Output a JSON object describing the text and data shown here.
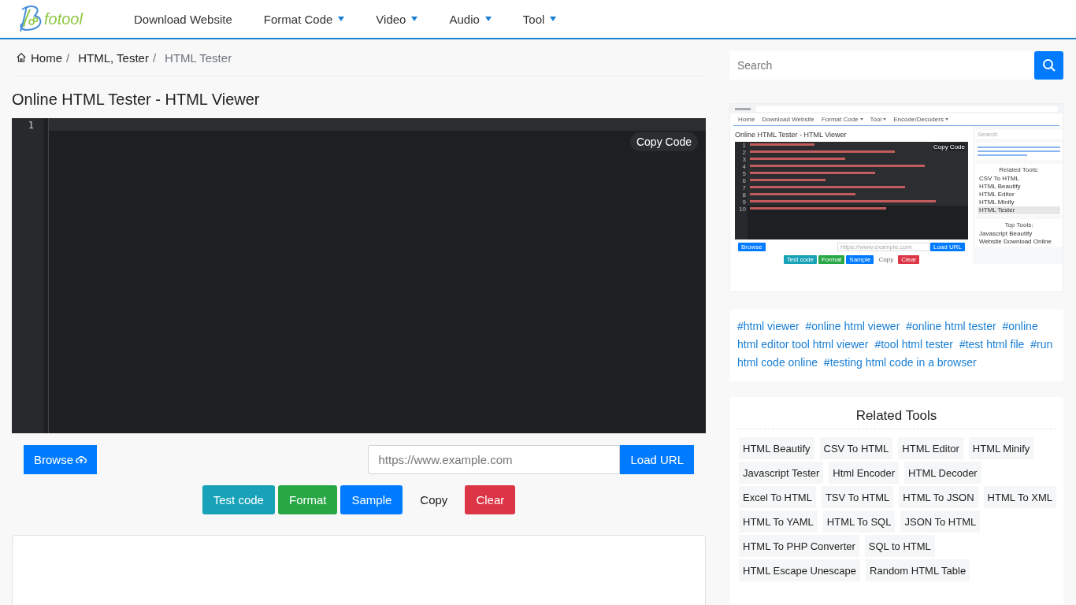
{
  "logo": {
    "text": "fotool"
  },
  "nav": [
    {
      "label": "Download Website",
      "dropdown": false
    },
    {
      "label": "Format Code",
      "dropdown": true
    },
    {
      "label": "Video",
      "dropdown": true
    },
    {
      "label": "Audio",
      "dropdown": true
    },
    {
      "label": "Tool",
      "dropdown": true
    }
  ],
  "breadcrumb": [
    {
      "label": "Home",
      "kind": "home",
      "separator": "/"
    },
    {
      "label": "HTML, Tester",
      "kind": "link",
      "separator": "/"
    },
    {
      "label": "HTML Tester",
      "kind": "current"
    }
  ],
  "title": "Online HTML Tester - HTML Viewer",
  "editor": {
    "line_numbers": [
      "1"
    ],
    "copy_button": "Copy Code"
  },
  "browse_button": "Browse",
  "url_field": {
    "placeholder": "https://www.example.com"
  },
  "load_button": "Load URL",
  "actions": [
    {
      "label": "Test code",
      "kind": "filled",
      "color": "#17a2b8"
    },
    {
      "label": "Format",
      "kind": "filled",
      "color": "#28a745"
    },
    {
      "label": "Sample",
      "kind": "filled",
      "color": "#007bff"
    },
    {
      "label": "Copy",
      "kind": "plain"
    },
    {
      "label": "Clear",
      "kind": "filled",
      "color": "#dc3545"
    }
  ],
  "search": {
    "placeholder": "Search"
  },
  "preview": {
    "nav": [
      {
        "label": "Home",
        "dropdown": false
      },
      {
        "label": "Download Website",
        "dropdown": false
      },
      {
        "label": "Format Code",
        "dropdown": true
      },
      {
        "label": "Tool",
        "dropdown": true
      },
      {
        "label": "Encode/Decoders",
        "dropdown": true
      }
    ],
    "title": "Online HTML Tester - HTML Viewer",
    "copy_button": "Copy Code",
    "line_numbers": [
      "1",
      "2",
      "3",
      "4",
      "5",
      "6",
      "7",
      "8",
      "9",
      "10"
    ],
    "search_placeholder": "Search",
    "related_title": "Related Tools:",
    "related_items": [
      {
        "label": "CSV To HTML",
        "selected": false
      },
      {
        "label": "HTML Beautify",
        "selected": false
      },
      {
        "label": "HTML Editor",
        "selected": false
      },
      {
        "label": "HTML Minify",
        "selected": false
      },
      {
        "label": "HTML Tester",
        "selected": true
      }
    ],
    "browse_button": "Browse",
    "url_placeholder": "https://www.example.com",
    "load_button": "Load URL",
    "actions": [
      {
        "label": "Test code",
        "kind": "filled",
        "color": "#17a2b8"
      },
      {
        "label": "Format",
        "kind": "filled",
        "color": "#28a745"
      },
      {
        "label": "Sample",
        "kind": "filled",
        "color": "#007bff"
      },
      {
        "label": "Copy",
        "kind": "plain"
      },
      {
        "label": "Clear",
        "kind": "filled",
        "color": "#dc3545"
      }
    ],
    "top_title": "Top Tools:",
    "top_items": [
      "Javascript Beautify",
      "Website Download Online"
    ]
  },
  "tags": [
    "#html viewer",
    "#online html viewer",
    "#online html tester",
    "#online html editor tool html viewer",
    "#tool html tester",
    "#test html file",
    "#run html code online",
    "#testing html code in a browser"
  ],
  "related": {
    "title": "Related Tools",
    "items": [
      "HTML Beautify",
      "CSV To HTML",
      "HTML Editor",
      "HTML Minify",
      "Javascript Tester",
      "Html Encoder",
      "HTML Decoder",
      "Excel To HTML",
      "TSV To HTML",
      "HTML To JSON",
      "HTML To XML",
      "HTML To YAML",
      "HTML To SQL",
      "JSON To HTML",
      "HTML To PHP Converter",
      "SQL to HTML",
      "HTML Escape Unescape",
      "Random HTML Table"
    ]
  }
}
